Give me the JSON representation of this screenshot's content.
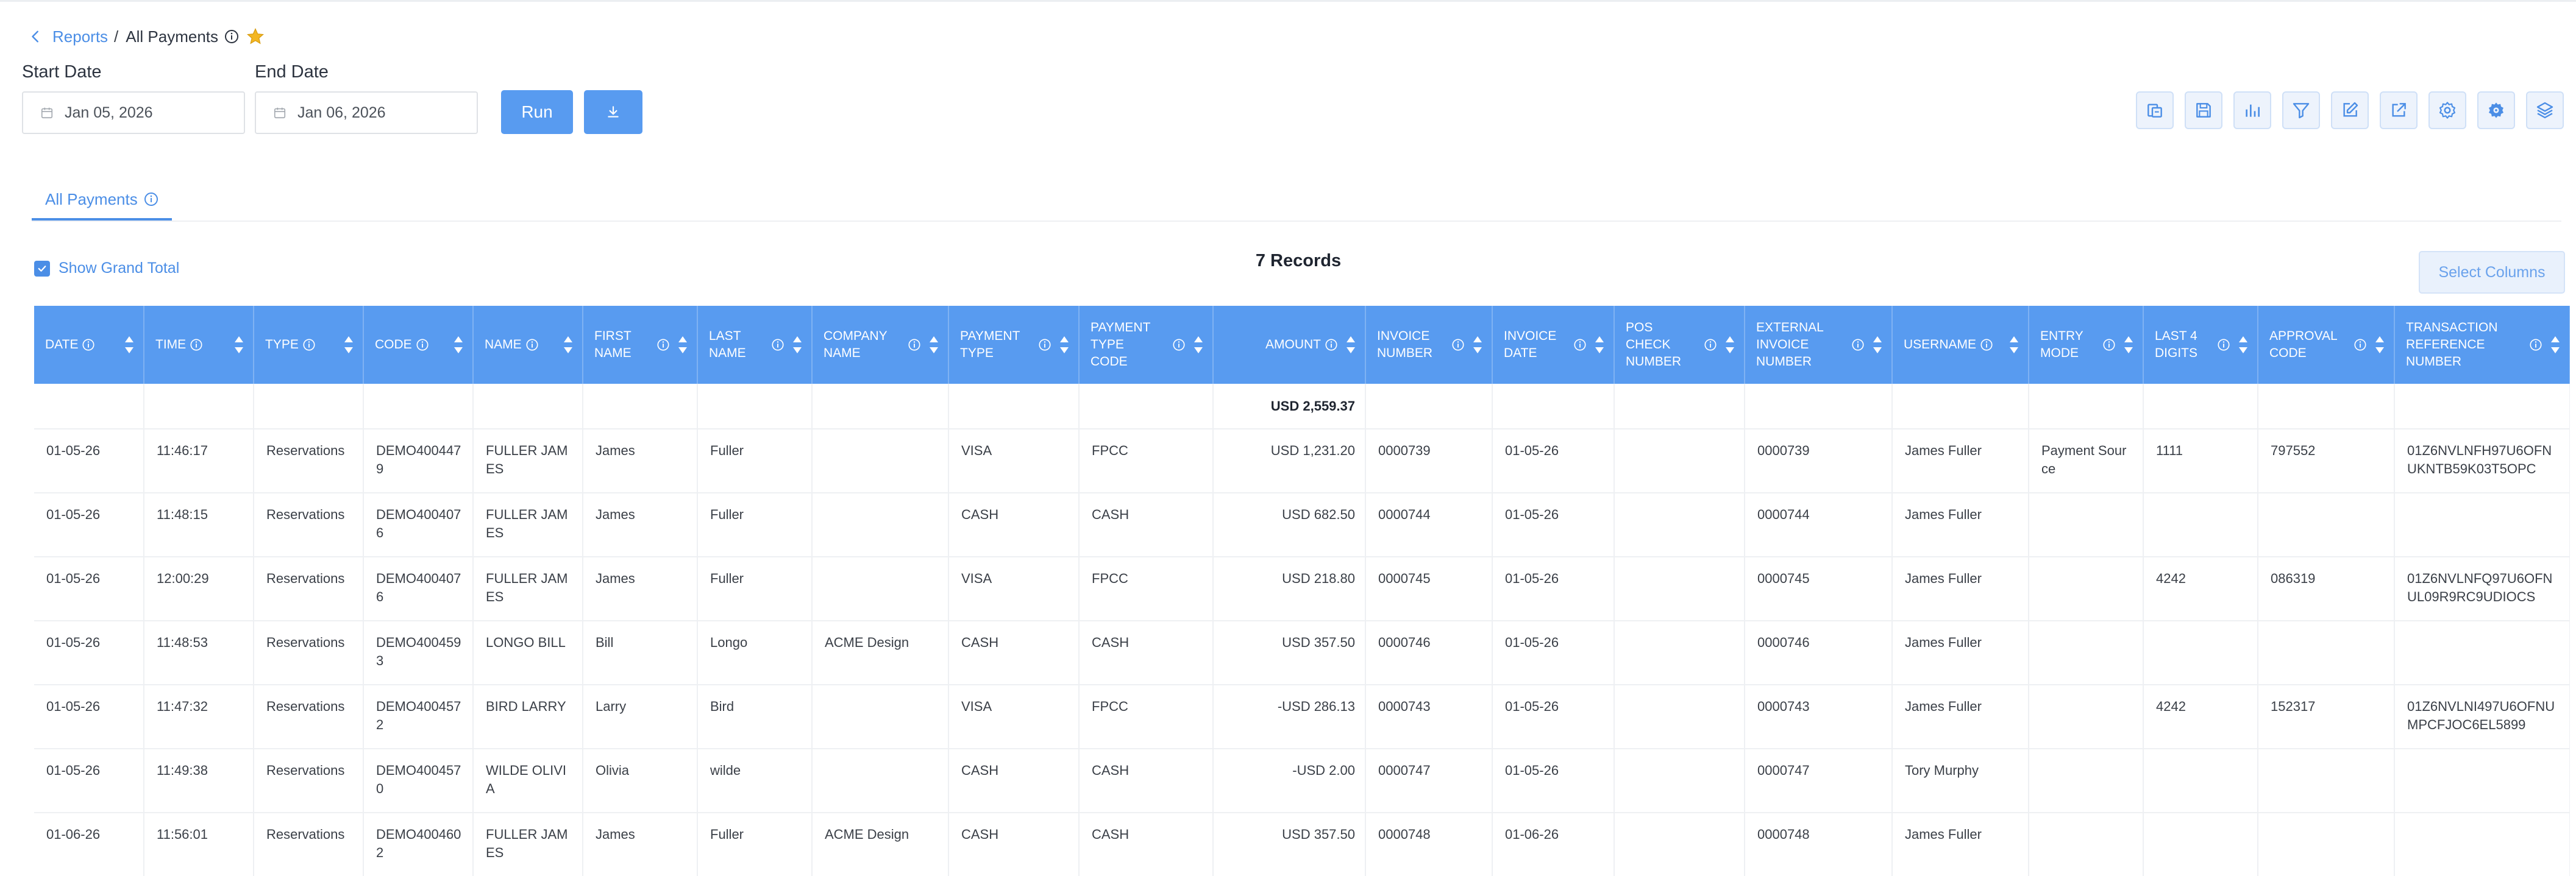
{
  "breadcrumb": {
    "parent": "Reports",
    "separator": "/",
    "current": "All Payments"
  },
  "filters": {
    "start_label": "Start Date",
    "end_label": "End Date",
    "start_value": "Jan 05, 2026",
    "end_value": "Jan 06, 2026",
    "run_label": "Run"
  },
  "toolbar": [
    {
      "icon": "print-icon"
    },
    {
      "icon": "save-icon"
    },
    {
      "icon": "bar-chart-icon"
    },
    {
      "icon": "filter-icon"
    },
    {
      "icon": "edit-icon"
    },
    {
      "icon": "external-link-icon"
    },
    {
      "icon": "gear-icon"
    },
    {
      "icon": "advanced-settings-icon"
    },
    {
      "icon": "layers-icon"
    }
  ],
  "tab": {
    "label": "All Payments"
  },
  "grand_total_label": "Show Grand Total",
  "records_label": "7 Records",
  "select_columns_label": "Select Columns",
  "colors": {
    "accent": "#589bf0",
    "link": "#4b8ee6",
    "star": "#f3b622"
  },
  "table": {
    "headers": [
      [
        "Date"
      ],
      [
        "Time"
      ],
      [
        "Type"
      ],
      [
        "Code"
      ],
      [
        "Name"
      ],
      [
        "First",
        "Name"
      ],
      [
        "Last",
        "Name"
      ],
      [
        "Company",
        "Name"
      ],
      [
        "Payment",
        "Type"
      ],
      [
        "Payment",
        "Type",
        "Code"
      ],
      [
        "Amount"
      ],
      [
        "Invoice",
        "Number"
      ],
      [
        "Invoice",
        "Date"
      ],
      [
        "POS",
        "Check",
        "Number"
      ],
      [
        "External",
        "Invoice",
        "Number"
      ],
      [
        "Username"
      ],
      [
        "Entry",
        "Mode"
      ],
      [
        "Last 4",
        "Digits"
      ],
      [
        "Approval",
        "Code"
      ],
      [
        "Transaction",
        "Reference",
        "Number"
      ]
    ],
    "grand_total_amount": "USD 2,559.37",
    "rows": [
      [
        "01-05-26",
        "11:46:17",
        "Reservations",
        "DEMO4004479",
        "FULLER JAMES",
        "James",
        "Fuller",
        "",
        "VISA",
        "FPCC",
        "USD 1,231.20",
        "0000739",
        "01-05-26",
        "",
        "0000739",
        "James Fuller",
        "Payment Source",
        "1111",
        "797552",
        "01Z6NVLNFH97U6OFNUKNTB59K03T5OPC"
      ],
      [
        "01-05-26",
        "11:48:15",
        "Reservations",
        "DEMO4004076",
        "FULLER JAMES",
        "James",
        "Fuller",
        "",
        "CASH",
        "CASH",
        "USD 682.50",
        "0000744",
        "01-05-26",
        "",
        "0000744",
        "James Fuller",
        "",
        "",
        "",
        ""
      ],
      [
        "01-05-26",
        "12:00:29",
        "Reservations",
        "DEMO4004076",
        "FULLER JAMES",
        "James",
        "Fuller",
        "",
        "VISA",
        "FPCC",
        "USD 218.80",
        "0000745",
        "01-05-26",
        "",
        "0000745",
        "James Fuller",
        "",
        "4242",
        "086319",
        "01Z6NVLNFQ97U6OFNUL09R9RC9UDIOCS"
      ],
      [
        "01-05-26",
        "11:48:53",
        "Reservations",
        "DEMO4004593",
        "LONGO BILL",
        "Bill",
        "Longo",
        "ACME Design",
        "CASH",
        "CASH",
        "USD 357.50",
        "0000746",
        "01-05-26",
        "",
        "0000746",
        "James Fuller",
        "",
        "",
        "",
        ""
      ],
      [
        "01-05-26",
        "11:47:32",
        "Reservations",
        "DEMO4004572",
        "BIRD LARRY",
        "Larry",
        "Bird",
        "",
        "VISA",
        "FPCC",
        "-USD 286.13",
        "0000743",
        "01-05-26",
        "",
        "0000743",
        "James Fuller",
        "",
        "4242",
        "152317",
        "01Z6NVLNI497U6OFNUMPCFJOC6EL5899"
      ],
      [
        "01-05-26",
        "11:49:38",
        "Reservations",
        "DEMO4004570",
        "WILDE OLIVIA",
        "Olivia",
        "wilde",
        "",
        "CASH",
        "CASH",
        "-USD 2.00",
        "0000747",
        "01-05-26",
        "",
        "0000747",
        "Tory Murphy",
        "",
        "",
        "",
        ""
      ],
      [
        "01-06-26",
        "11:56:01",
        "Reservations",
        "DEMO4004602",
        "FULLER JAMES",
        "James",
        "Fuller",
        "ACME Design",
        "CASH",
        "CASH",
        "USD 357.50",
        "0000748",
        "01-06-26",
        "",
        "0000748",
        "James Fuller",
        "",
        "",
        "",
        ""
      ]
    ]
  }
}
